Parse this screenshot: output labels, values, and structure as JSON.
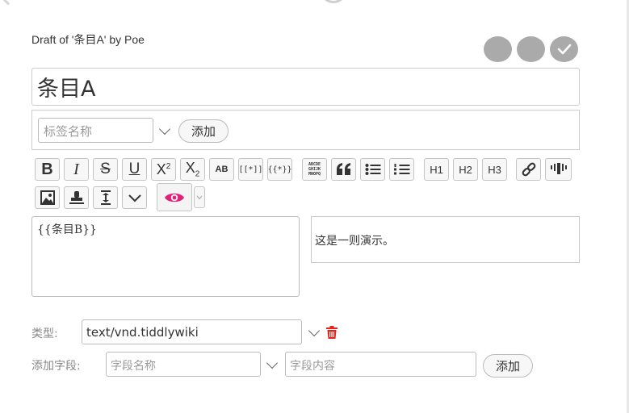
{
  "header": {
    "draft_title": "Draft of '条目A' by Poe"
  },
  "title_field": {
    "value": "条目A"
  },
  "tags": {
    "placeholder": "标签名称",
    "add_label": "添加"
  },
  "toolbar": {
    "row1": [
      "bold",
      "italic",
      "strikethrough",
      "underline",
      "superscript",
      "subscript",
      "smallcaps",
      "wikilink",
      "transclude",
      "monospaced",
      "quote",
      "bullet-list",
      "numbered-list",
      "heading-1",
      "heading-2",
      "heading-3",
      "link",
      "more"
    ],
    "row2": [
      "picture",
      "stamp",
      "size",
      "more-options",
      "preview-toggle",
      "preview-type"
    ],
    "superscript_label": "X",
    "superscript_mark": "2",
    "subscript_label": "X",
    "subscript_mark": "2",
    "smallcaps_label": "AB",
    "wikilink_label": "[[*]]",
    "transclude_label": "{{*}}",
    "mono_lines": [
      "ABCDE",
      "GHIJK",
      "MNOPQ"
    ],
    "h1_label": "H1",
    "h2_label": "H2",
    "h3_label": "H3",
    "bold_label": "B",
    "italic_label": "I",
    "strike_label": "S",
    "underline_label": "U",
    "accent_color": "#e0227a"
  },
  "editor": {
    "text": "{{条目B}}"
  },
  "preview": {
    "text": "这是一则演示。"
  },
  "type_row": {
    "label": "类型:",
    "value": "text/vnd.tiddlywiki",
    "delete_color": "#e2261d"
  },
  "fields_row": {
    "label": "添加字段:",
    "name_placeholder": "字段名称",
    "value_placeholder": "字段内容",
    "add_label": "添加"
  }
}
